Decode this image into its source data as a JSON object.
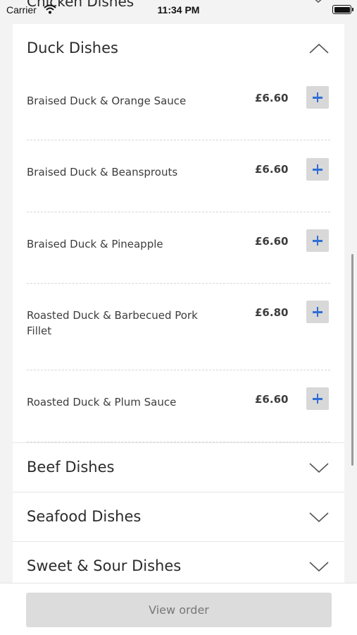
{
  "status_bar": {
    "carrier": "Carrier",
    "time": "11:34 PM"
  },
  "peek_section": {
    "title": "Chicken Dishes"
  },
  "expanded_section": {
    "title": "Duck Dishes",
    "items": [
      {
        "name": "Braised Duck & Orange Sauce",
        "price": "£6.60"
      },
      {
        "name": "Braised Duck & Beansprouts",
        "price": "£6.60"
      },
      {
        "name": "Braised Duck & Pineapple",
        "price": "£6.60"
      },
      {
        "name": "Roasted Duck & Barbecued Pork Fillet",
        "price": "£6.80"
      },
      {
        "name": "Roasted Duck & Plum Sauce",
        "price": "£6.60"
      }
    ]
  },
  "collapsed_sections": [
    {
      "title": "Beef Dishes"
    },
    {
      "title": "Seafood Dishes"
    },
    {
      "title": "Sweet & Sour Dishes"
    }
  ],
  "footer": {
    "view_order_label": "View order"
  },
  "colors": {
    "accent": "#2f6fd6",
    "button_bg": "#d8d8d8",
    "page_bg": "#f3f3f3"
  },
  "icons": {
    "add": "plus-icon",
    "expanded": "chevron-up-icon",
    "collapsed": "chevron-down-icon"
  }
}
